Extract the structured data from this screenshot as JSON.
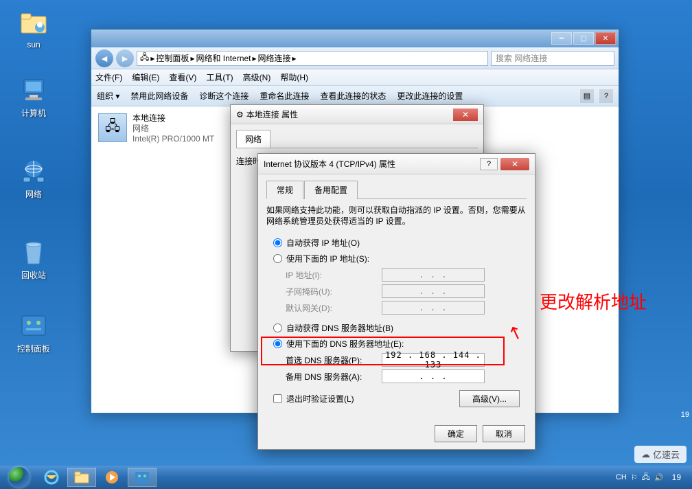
{
  "desktop": {
    "icons": [
      {
        "label": "sun"
      },
      {
        "label": "计算机"
      },
      {
        "label": "网络"
      },
      {
        "label": "回收站"
      },
      {
        "label": "控制面板"
      }
    ]
  },
  "explorer": {
    "breadcrumb": [
      "控制面板",
      "网络和 Internet",
      "网络连接"
    ],
    "search_placeholder": "搜索 网络连接",
    "menu": [
      "文件(F)",
      "编辑(E)",
      "查看(V)",
      "工具(T)",
      "高级(N)",
      "帮助(H)"
    ],
    "toolbar": [
      "组织 ▾",
      "禁用此网络设备",
      "诊断这个连接",
      "重命名此连接",
      "查看此连接的状态",
      "更改此连接的设置"
    ],
    "conn": {
      "name": "本地连接",
      "status": "网络",
      "adapter": "Intel(R) PRO/1000 MT"
    }
  },
  "prop_dialog": {
    "title": "本地连接 属性",
    "tab_network": "网络",
    "conn_uses": "连接时使用:"
  },
  "ip_dialog": {
    "title": "Internet 协议版本 4 (TCP/IPv4) 属性",
    "tab_general": "常规",
    "tab_alt": "备用配置",
    "description": "如果网络支持此功能，则可以获取自动指派的 IP 设置。否则，您需要从网络系统管理员处获得适当的 IP 设置。",
    "auto_ip": "自动获得 IP 地址(O)",
    "manual_ip": "使用下面的 IP 地址(S):",
    "ip_addr": "IP 地址(I):",
    "subnet": "子网掩码(U):",
    "gateway": "默认网关(D):",
    "auto_dns": "自动获得 DNS 服务器地址(B)",
    "manual_dns": "使用下面的 DNS 服务器地址(E):",
    "pref_dns": "首选 DNS 服务器(P):",
    "pref_dns_value": "192 . 168 . 144 . 133",
    "alt_dns": "备用 DNS 服务器(A):",
    "alt_dns_value": ". . .",
    "validate": "退出时验证设置(L)",
    "advanced": "高级(V)...",
    "ok": "确定",
    "cancel": "取消"
  },
  "annotation": {
    "label": "更改解析地址"
  },
  "taskbar": {
    "ime": "CH",
    "clock": "19"
  },
  "watermark": "亿速云",
  "pagecount": "19"
}
